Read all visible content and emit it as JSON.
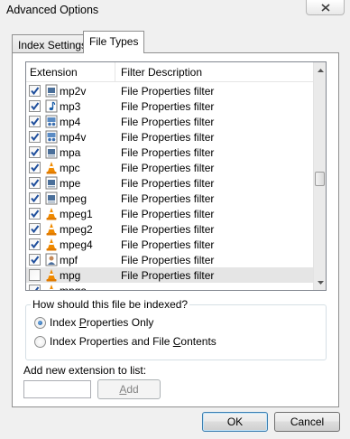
{
  "window": {
    "title": "Advanced Options"
  },
  "tabs": [
    {
      "label": "Index Settings",
      "active": false
    },
    {
      "label": "File Types",
      "active": true
    }
  ],
  "list": {
    "columns": {
      "extension": "Extension",
      "description": "Filter Description"
    },
    "rows": [
      {
        "ext": "mp2v",
        "desc": "File Properties filter",
        "checked": true,
        "icon": "video-file-icon"
      },
      {
        "ext": "mp3",
        "desc": "File Properties filter",
        "checked": true,
        "icon": "music-note-icon"
      },
      {
        "ext": "mp4",
        "desc": "File Properties filter",
        "checked": true,
        "icon": "media-file-icon"
      },
      {
        "ext": "mp4v",
        "desc": "File Properties filter",
        "checked": true,
        "icon": "media-file-icon"
      },
      {
        "ext": "mpa",
        "desc": "File Properties filter",
        "checked": true,
        "icon": "video-file-icon"
      },
      {
        "ext": "mpc",
        "desc": "File Properties filter",
        "checked": true,
        "icon": "vlc-cone-icon"
      },
      {
        "ext": "mpe",
        "desc": "File Properties filter",
        "checked": true,
        "icon": "video-file-icon"
      },
      {
        "ext": "mpeg",
        "desc": "File Properties filter",
        "checked": true,
        "icon": "video-file-icon"
      },
      {
        "ext": "mpeg1",
        "desc": "File Properties filter",
        "checked": true,
        "icon": "vlc-cone-icon"
      },
      {
        "ext": "mpeg2",
        "desc": "File Properties filter",
        "checked": true,
        "icon": "vlc-cone-icon"
      },
      {
        "ext": "mpeg4",
        "desc": "File Properties filter",
        "checked": true,
        "icon": "vlc-cone-icon"
      },
      {
        "ext": "mpf",
        "desc": "File Properties filter",
        "checked": true,
        "icon": "contact-file-icon"
      },
      {
        "ext": "mpg",
        "desc": "File Properties filter",
        "checked": false,
        "icon": "vlc-cone-icon"
      },
      {
        "ext": "mpga",
        "desc": "",
        "checked": true,
        "icon": "vlc-cone-icon"
      }
    ],
    "selected_index": 12
  },
  "index_group": {
    "legend": "How should this file be indexed?",
    "options": [
      {
        "pre": "Index ",
        "accel": "P",
        "post": "roperties Only",
        "selected": true
      },
      {
        "pre": "Index Properties and File ",
        "accel": "C",
        "post": "ontents",
        "selected": false
      }
    ]
  },
  "add": {
    "label": "Add new extension to list:",
    "input_value": "",
    "button_accel": "A",
    "button_rest": "dd"
  },
  "buttons": {
    "ok": "OK",
    "cancel": "Cancel"
  },
  "colors": {
    "check": "#1e4e9c",
    "selected_row": "#e5e5e5",
    "vlc_orange": "#f08a00"
  }
}
